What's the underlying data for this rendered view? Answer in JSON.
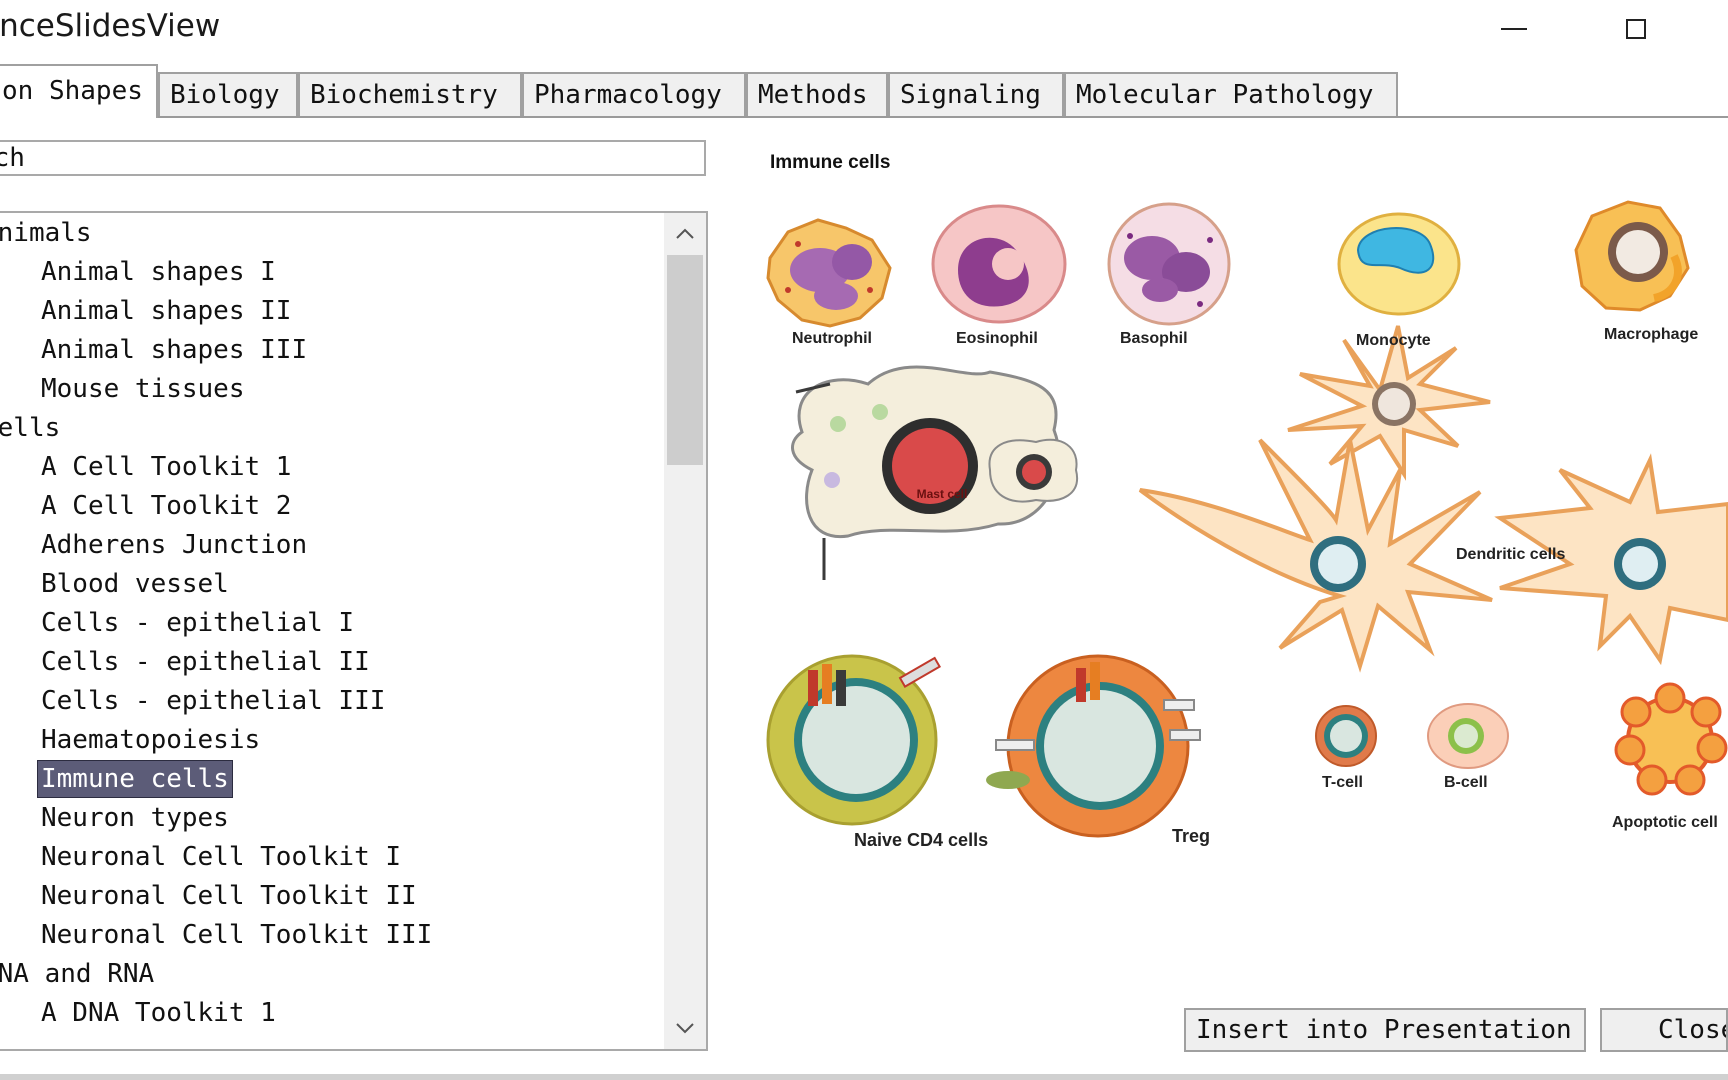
{
  "window": {
    "title": "enceSlidesView"
  },
  "tabs": [
    {
      "label": "on Shapes"
    },
    {
      "label": "Biology"
    },
    {
      "label": "Biochemistry"
    },
    {
      "label": "Pharmacology"
    },
    {
      "label": "Methods"
    },
    {
      "label": "Signaling"
    },
    {
      "label": "Molecular Pathology"
    }
  ],
  "search": {
    "value": "rch",
    "placeholder": "rch"
  },
  "tree": {
    "items": [
      {
        "label": "Animals",
        "level": 0
      },
      {
        "label": "Animal shapes I",
        "level": 1
      },
      {
        "label": "Animal shapes II",
        "level": 1
      },
      {
        "label": "Animal shapes III",
        "level": 1
      },
      {
        "label": "Mouse tissues",
        "level": 1
      },
      {
        "label": "Cells",
        "level": 0
      },
      {
        "label": "A Cell Toolkit 1",
        "level": 1
      },
      {
        "label": "A Cell Toolkit 2",
        "level": 1
      },
      {
        "label": "Adherens Junction",
        "level": 1
      },
      {
        "label": "Blood vessel",
        "level": 1
      },
      {
        "label": "Cells - epithelial I",
        "level": 1
      },
      {
        "label": "Cells - epithelial II",
        "level": 1
      },
      {
        "label": "Cells - epithelial III",
        "level": 1
      },
      {
        "label": "Haematopoiesis",
        "level": 1
      },
      {
        "label": "Immune cells",
        "level": 1,
        "selected": true
      },
      {
        "label": "Neuron types",
        "level": 1
      },
      {
        "label": "Neuronal Cell Toolkit I",
        "level": 1
      },
      {
        "label": "Neuronal Cell Toolkit II",
        "level": 1
      },
      {
        "label": "Neuronal Cell Toolkit III",
        "level": 1
      },
      {
        "label": "DNA and RNA",
        "level": 0
      },
      {
        "label": "A DNA Toolkit 1",
        "level": 1
      }
    ]
  },
  "preview": {
    "title": "Immune cells",
    "labels": {
      "neutrophil": "Neutrophil",
      "eosinophil": "Eosinophil",
      "basophil": "Basophil",
      "monocyte": "Monocyte",
      "macrophage": "Macrophage",
      "mast_cell": "Mast cell",
      "dendritic": "Dendritic cells",
      "naive_cd4": "Naive CD4 cells",
      "treg": "Treg",
      "tcell": "T-cell",
      "bcell": "B-cell",
      "apoptotic": "Apoptotic cell"
    }
  },
  "buttons": {
    "insert": "Insert into Presentation",
    "close": "Close"
  },
  "colors": {
    "selection": "#5c5c78",
    "border": "#a0a0a0"
  }
}
